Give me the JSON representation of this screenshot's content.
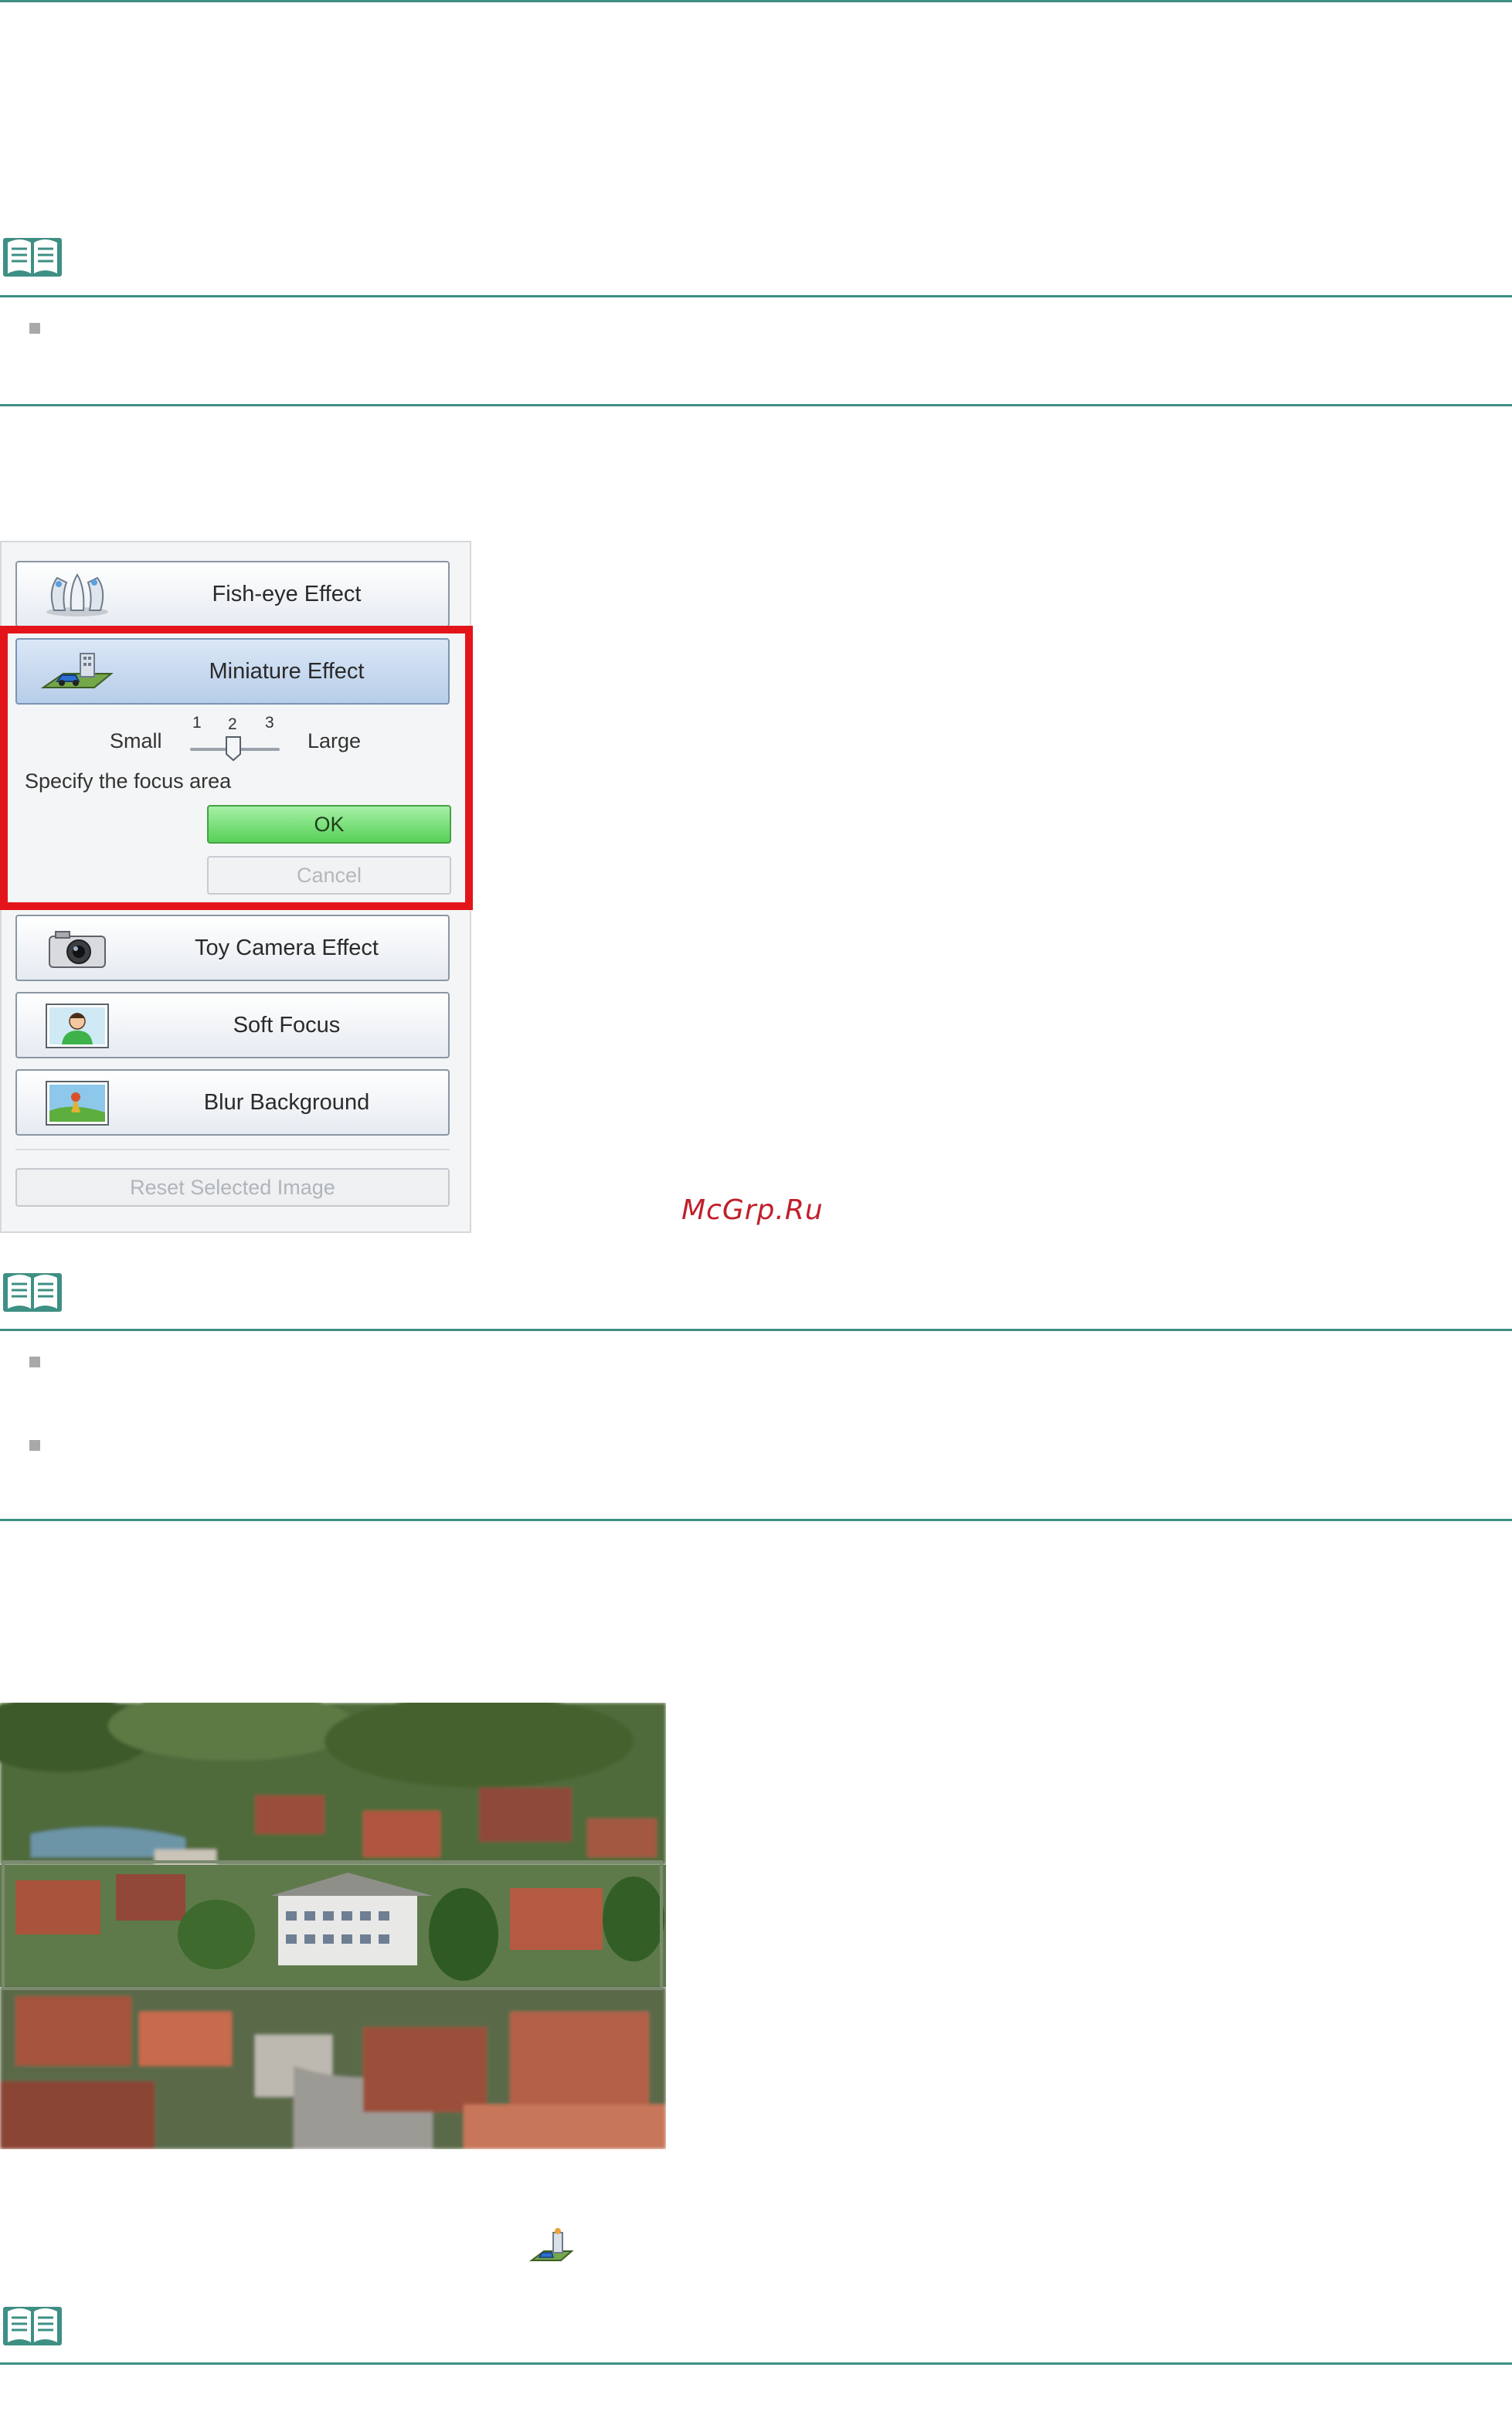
{
  "panel": {
    "buttons": [
      {
        "label": "Fish-eye Effect",
        "icon": "fisheye-icon"
      },
      {
        "label": "Miniature Effect",
        "icon": "miniature-icon"
      },
      {
        "label": "Toy Camera Effect",
        "icon": "camera-icon"
      },
      {
        "label": "Soft Focus",
        "icon": "portrait-icon"
      },
      {
        "label": "Blur Background",
        "icon": "landscape-icon"
      }
    ],
    "slider": {
      "small_label": "Small",
      "large_label": "Large",
      "ticks": [
        "1",
        "2",
        "3"
      ],
      "value": 2
    },
    "focus_text": "Specify the focus area",
    "ok_label": "OK",
    "cancel_label": "Cancel",
    "reset_label": "Reset Selected Image"
  },
  "watermark": "McGrp.Ru",
  "colors": {
    "rule": "#3e8f84",
    "highlight": "#e3151a",
    "ok": "#57d157"
  }
}
